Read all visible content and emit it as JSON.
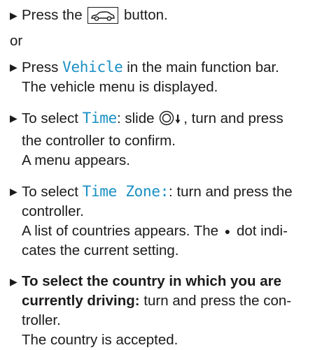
{
  "step1": {
    "prefix": "Press the",
    "icon": "vehicle-button-icon",
    "suffix": "button."
  },
  "or_text": "or",
  "step2": {
    "prefix": "Press",
    "ui_label": "Vehicle",
    "suffix": "in the main function bar.",
    "result": "The vehicle menu is displayed."
  },
  "step3": {
    "prefix": "To select",
    "ui_label": "Time",
    "colon_slide": ": slide",
    "icon": "controller-slide-down-icon",
    "suffix": ", turn and press",
    "line2": "the controller to confirm.",
    "result": "A menu appears."
  },
  "step4": {
    "prefix": "To select",
    "ui_label": "Time Zone:",
    "suffix": ": turn and press the",
    "line2": "controller.",
    "result_line1_a": "A list of countries appears. The",
    "dot_icon": "bullet-dot-icon",
    "result_line1_b": "dot indi-",
    "result_line2": "cates the current setting."
  },
  "step5": {
    "bold_line1": "To select the country in which you are",
    "bold_line2": "currently driving:",
    "suffix_line2": "turn and press the con-",
    "line3": "troller.",
    "result": "The country is accepted."
  },
  "colors": {
    "text": "#1b1b1b",
    "ui_label": "#1a8fc4"
  }
}
